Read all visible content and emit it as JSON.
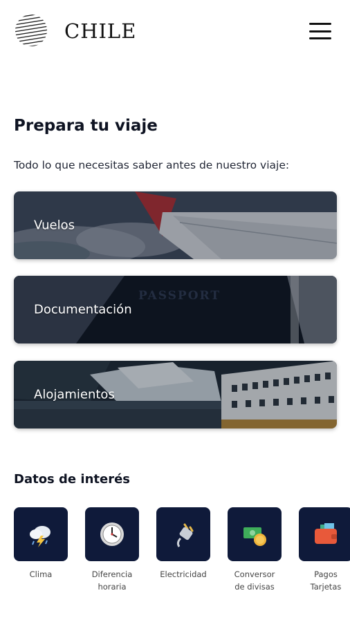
{
  "header": {
    "logo_text": "CHILE",
    "menu_icon": "hamburger-icon"
  },
  "main": {
    "title": "Prepara tu viaje",
    "subtitle": "Todo lo que necesitas saber antes de nuestro viaje:",
    "cards": [
      {
        "label": "Vuelos"
      },
      {
        "label": "Documentación"
      },
      {
        "label": "Alojamientos"
      }
    ]
  },
  "datos": {
    "title": "Datos de interés",
    "items": [
      {
        "label": "Clima",
        "icon": "weather-storm-icon"
      },
      {
        "label": "Diferencia\nhoraria",
        "icon": "clock-icon"
      },
      {
        "label": "Electricidad",
        "icon": "plug-icon"
      },
      {
        "label": "Conversor\nde divisas",
        "icon": "money-icon"
      },
      {
        "label": "Pagos\nTarjetas",
        "icon": "wallet-icon"
      }
    ]
  }
}
